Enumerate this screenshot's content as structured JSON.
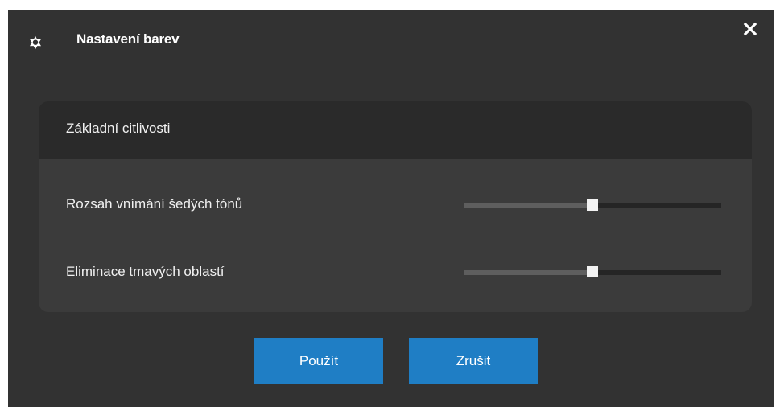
{
  "dialog": {
    "title": "Nastavení barev",
    "icon": "gear-icon",
    "close_icon": "close-icon"
  },
  "group": {
    "title": "Základní citlivosti",
    "rows": [
      {
        "label": "Rozsah vnímání šedých tónů",
        "value": 0.5
      },
      {
        "label": "Eliminace tmavých oblastí",
        "value": 0.5
      }
    ]
  },
  "buttons": {
    "apply_label": "Použít",
    "cancel_label": "Zrušit"
  },
  "colors": {
    "background": "#323232",
    "accent": "#1f7ec5"
  }
}
